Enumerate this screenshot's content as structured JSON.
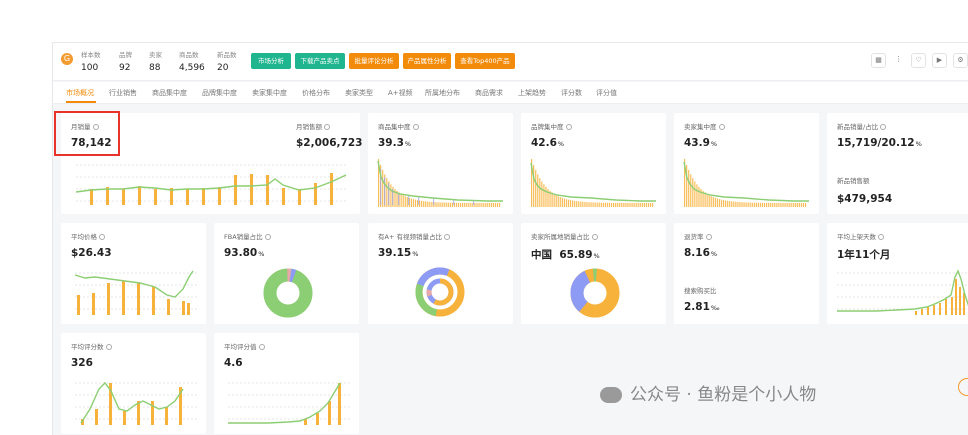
{
  "header": {
    "stats": [
      {
        "label": "样本数",
        "value": "100"
      },
      {
        "label": "品牌",
        "value": "92"
      },
      {
        "label": "卖家",
        "value": "88"
      },
      {
        "label": "商品数",
        "value": "4,596"
      },
      {
        "label": "新品数",
        "value": "20"
      }
    ],
    "buttons": [
      {
        "label": "市场分析",
        "color": "#1fb58f"
      },
      {
        "label": "下载产品卖点",
        "color": "#1fb58f"
      },
      {
        "label": "批量评论分析",
        "color": "#f38b0a"
      },
      {
        "label": "产品属性分析",
        "color": "#f38b0a"
      },
      {
        "label": "查看Top400产品",
        "color": "#f38b0a"
      }
    ]
  },
  "tabs": [
    "市场概况",
    "行业销售",
    "商品集中度",
    "品牌集中度",
    "卖家集中度",
    "价格分布",
    "卖家类型",
    "A+视频",
    "所属地分布",
    "商品需求",
    "上架趋势",
    "评分数",
    "评分值"
  ],
  "cards": {
    "sales": {
      "label": "月销量",
      "value": "78,142",
      "label2": "月销售额",
      "value2": "$2,006,723"
    },
    "product_conc": {
      "label": "商品集中度",
      "value": "39.3",
      "unit": "%"
    },
    "brand_conc": {
      "label": "品牌集中度",
      "value": "42.6",
      "unit": "%"
    },
    "seller_conc": {
      "label": "卖家集中度",
      "value": "43.9",
      "unit": "%"
    },
    "new_products": {
      "label": "新品销量/占比",
      "value": "15,719/20.12",
      "unit": "%",
      "label2": "新品销售额",
      "value2": "$479,954"
    },
    "avg_price": {
      "label": "平均价格",
      "value": "$26.43"
    },
    "fba": {
      "label": "FBA销量占比",
      "value": "93.80",
      "unit": "%"
    },
    "aplus": {
      "label": "有A+ 有视频销量占比",
      "value": "39.15",
      "unit": "%"
    },
    "origin": {
      "label": "卖家所属地销量占比",
      "value": "中国",
      "value_b": "65.89",
      "unit": "%"
    },
    "returns": {
      "label": "退货率",
      "value": "8.16",
      "unit": "%",
      "label2": "搜索购买比",
      "value2": "2.81",
      "unit2": "‰"
    },
    "avg_days": {
      "label": "平均上架天数",
      "value": "1年11个月"
    },
    "avg_reviews": {
      "label": "平均评分数",
      "value": "326"
    },
    "avg_rating": {
      "label": "平均评分值",
      "value": "4.6"
    }
  },
  "watermark": "公众号 · 鱼粉是个小人物",
  "colors": {
    "green": "#8cce73",
    "orange": "#f7b23b",
    "blue": "#8e9bf5",
    "red": "#e8332b",
    "accent": "#f38b0a"
  }
}
